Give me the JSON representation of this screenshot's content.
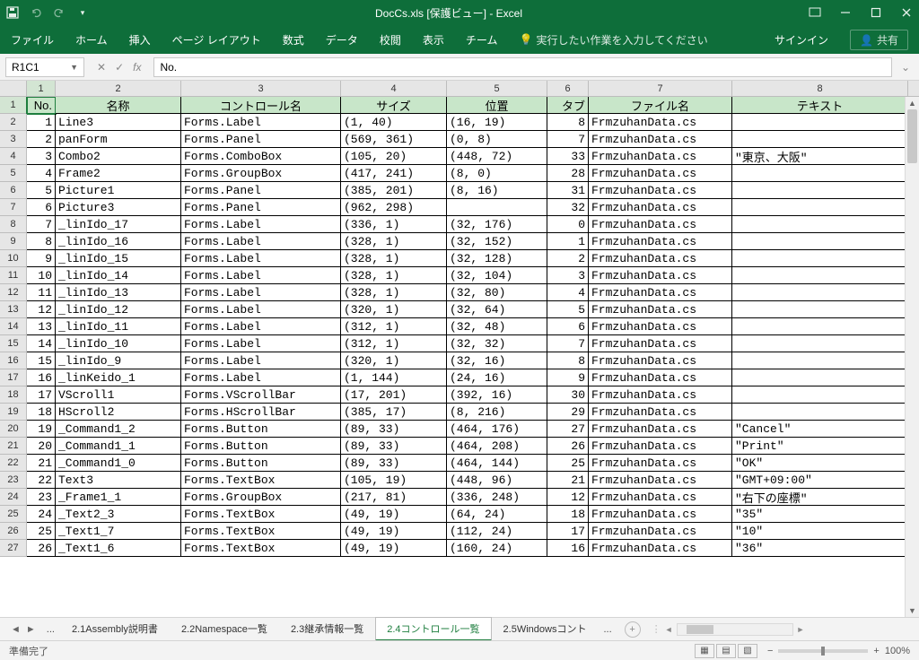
{
  "title": "DocCs.xls [保護ビュー] - Excel",
  "ribbon": {
    "tabs": [
      "ファイル",
      "ホーム",
      "挿入",
      "ページ レイアウト",
      "数式",
      "データ",
      "校閲",
      "表示",
      "チーム"
    ],
    "tell": "実行したい作業を入力してください",
    "signin": "サインイン",
    "share": "共有"
  },
  "namebox": "R1C1",
  "formula": "No.",
  "colLabels": [
    "1",
    "2",
    "3",
    "4",
    "5",
    "6",
    "7",
    "8"
  ],
  "headers": [
    "No.",
    "名称",
    "コントロール名",
    "サイズ",
    "位置",
    "タブ",
    "ファイル名",
    "テキスト"
  ],
  "rows": [
    {
      "n": "1",
      "name": "Line3",
      "ctrl": "Forms.Label",
      "size": "(1, 40)",
      "pos": "(16, 19)",
      "tab": "8",
      "file": "FrmzuhanData.cs",
      "txt": ""
    },
    {
      "n": "2",
      "name": "panForm",
      "ctrl": "Forms.Panel",
      "size": "(569, 361)",
      "pos": "(0, 8)",
      "tab": "7",
      "file": "FrmzuhanData.cs",
      "txt": ""
    },
    {
      "n": "3",
      "name": "Combo2",
      "ctrl": "Forms.ComboBox",
      "size": "(105, 20)",
      "pos": "(448, 72)",
      "tab": "33",
      "file": "FrmzuhanData.cs",
      "txt": "\"東京、大阪\""
    },
    {
      "n": "4",
      "name": "Frame2",
      "ctrl": "Forms.GroupBox",
      "size": "(417, 241)",
      "pos": "(8, 0)",
      "tab": "28",
      "file": "FrmzuhanData.cs",
      "txt": ""
    },
    {
      "n": "5",
      "name": "Picture1",
      "ctrl": "Forms.Panel",
      "size": "(385, 201)",
      "pos": "(8, 16)",
      "tab": "31",
      "file": "FrmzuhanData.cs",
      "txt": ""
    },
    {
      "n": "6",
      "name": "Picture3",
      "ctrl": "Forms.Panel",
      "size": "(962, 298)",
      "pos": "",
      "tab": "32",
      "file": "FrmzuhanData.cs",
      "txt": ""
    },
    {
      "n": "7",
      "name": "_linIdo_17",
      "ctrl": "Forms.Label",
      "size": "(336, 1)",
      "pos": "(32, 176)",
      "tab": "0",
      "file": "FrmzuhanData.cs",
      "txt": ""
    },
    {
      "n": "8",
      "name": "_linIdo_16",
      "ctrl": "Forms.Label",
      "size": "(328, 1)",
      "pos": "(32, 152)",
      "tab": "1",
      "file": "FrmzuhanData.cs",
      "txt": ""
    },
    {
      "n": "9",
      "name": "_linIdo_15",
      "ctrl": "Forms.Label",
      "size": "(328, 1)",
      "pos": "(32, 128)",
      "tab": "2",
      "file": "FrmzuhanData.cs",
      "txt": ""
    },
    {
      "n": "10",
      "name": "_linIdo_14",
      "ctrl": "Forms.Label",
      "size": "(328, 1)",
      "pos": "(32, 104)",
      "tab": "3",
      "file": "FrmzuhanData.cs",
      "txt": ""
    },
    {
      "n": "11",
      "name": "_linIdo_13",
      "ctrl": "Forms.Label",
      "size": "(328, 1)",
      "pos": "(32, 80)",
      "tab": "4",
      "file": "FrmzuhanData.cs",
      "txt": ""
    },
    {
      "n": "12",
      "name": "_linIdo_12",
      "ctrl": "Forms.Label",
      "size": "(320, 1)",
      "pos": "(32, 64)",
      "tab": "5",
      "file": "FrmzuhanData.cs",
      "txt": ""
    },
    {
      "n": "13",
      "name": "_linIdo_11",
      "ctrl": "Forms.Label",
      "size": "(312, 1)",
      "pos": "(32, 48)",
      "tab": "6",
      "file": "FrmzuhanData.cs",
      "txt": ""
    },
    {
      "n": "14",
      "name": "_linIdo_10",
      "ctrl": "Forms.Label",
      "size": "(312, 1)",
      "pos": "(32, 32)",
      "tab": "7",
      "file": "FrmzuhanData.cs",
      "txt": ""
    },
    {
      "n": "15",
      "name": "_linIdo_9",
      "ctrl": "Forms.Label",
      "size": "(320, 1)",
      "pos": "(32, 16)",
      "tab": "8",
      "file": "FrmzuhanData.cs",
      "txt": ""
    },
    {
      "n": "16",
      "name": "_linKeido_1",
      "ctrl": "Forms.Label",
      "size": "(1, 144)",
      "pos": "(24, 16)",
      "tab": "9",
      "file": "FrmzuhanData.cs",
      "txt": ""
    },
    {
      "n": "17",
      "name": "VScroll1",
      "ctrl": "Forms.VScrollBar",
      "size": "(17, 201)",
      "pos": "(392, 16)",
      "tab": "30",
      "file": "FrmzuhanData.cs",
      "txt": ""
    },
    {
      "n": "18",
      "name": "HScroll2",
      "ctrl": "Forms.HScrollBar",
      "size": "(385, 17)",
      "pos": "(8, 216)",
      "tab": "29",
      "file": "FrmzuhanData.cs",
      "txt": ""
    },
    {
      "n": "19",
      "name": "_Command1_2",
      "ctrl": "Forms.Button",
      "size": "(89, 33)",
      "pos": "(464, 176)",
      "tab": "27",
      "file": "FrmzuhanData.cs",
      "txt": "\"Cancel\""
    },
    {
      "n": "20",
      "name": "_Command1_1",
      "ctrl": "Forms.Button",
      "size": "(89, 33)",
      "pos": "(464, 208)",
      "tab": "26",
      "file": "FrmzuhanData.cs",
      "txt": "\"Print\""
    },
    {
      "n": "21",
      "name": "_Command1_0",
      "ctrl": "Forms.Button",
      "size": "(89, 33)",
      "pos": "(464, 144)",
      "tab": "25",
      "file": "FrmzuhanData.cs",
      "txt": "\"OK\""
    },
    {
      "n": "22",
      "name": "Text3",
      "ctrl": "Forms.TextBox",
      "size": "(105, 19)",
      "pos": "(448, 96)",
      "tab": "21",
      "file": "FrmzuhanData.cs",
      "txt": "\"GMT+09:00\""
    },
    {
      "n": "23",
      "name": "_Frame1_1",
      "ctrl": "Forms.GroupBox",
      "size": "(217, 81)",
      "pos": "(336, 248)",
      "tab": "12",
      "file": "FrmzuhanData.cs",
      "txt": "\"右下の座標\""
    },
    {
      "n": "24",
      "name": "_Text2_3",
      "ctrl": "Forms.TextBox",
      "size": "(49, 19)",
      "pos": "(64, 24)",
      "tab": "18",
      "file": "FrmzuhanData.cs",
      "txt": "\"35\""
    },
    {
      "n": "25",
      "name": "_Text1_7",
      "ctrl": "Forms.TextBox",
      "size": "(49, 19)",
      "pos": "(112, 24)",
      "tab": "17",
      "file": "FrmzuhanData.cs",
      "txt": "\"10\""
    },
    {
      "n": "26",
      "name": "_Text1_6",
      "ctrl": "Forms.TextBox",
      "size": "(49, 19)",
      "pos": "(160, 24)",
      "tab": "16",
      "file": "FrmzuhanData.cs",
      "txt": "\"36\""
    }
  ],
  "sheets": [
    "2.1Assembly説明書",
    "2.2Namespace一覧",
    "2.3継承情報一覧",
    "2.4コントロール一覧",
    "2.5Windowsコント"
  ],
  "activeSheet": 3,
  "status": "準備完了",
  "zoom": "100%"
}
